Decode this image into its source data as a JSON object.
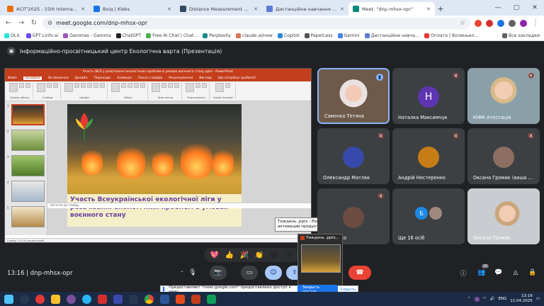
{
  "browser": {
    "tabs": [
      {
        "title": "ACIT'2025 - 15th International",
        "color": "#e8710a",
        "active": false
      },
      {
        "title": "Вхід | Kleks",
        "color": "#1a73e8",
        "active": false
      },
      {
        "title": "Distance Measurement using A",
        "color": "#34495e",
        "active": false
      },
      {
        "title": "Дистанційне навчання в ВСП",
        "color": "#5b7bd5",
        "active": false
      },
      {
        "title": "Meet: \"dnp-mhsx-opr\"",
        "color": "#00897b",
        "active": true
      }
    ],
    "url": "meet.google.com/dnp-mhsx-opr",
    "bookmarks": [
      {
        "label": "OLX.",
        "color": "#23e5db"
      },
      {
        "label": "GPT Linfo.ai",
        "color": "#6c4cf2"
      },
      {
        "label": "Gammas - Gamma",
        "color": "#9b59b6"
      },
      {
        "label": "ChatGPT",
        "color": "#202124"
      },
      {
        "label": "Free AI Chat | Chat...",
        "color": "#4caf50"
      },
      {
        "label": "Perplexity",
        "color": "#1f8a8a"
      },
      {
        "label": "claude.ai/new",
        "color": "#d97757"
      },
      {
        "label": "Copilot",
        "color": "#2b88d8"
      },
      {
        "label": "PaperLess",
        "color": "#555"
      },
      {
        "label": "Gemini",
        "color": "#4285f4"
      },
      {
        "label": "Дистанційне навча...",
        "color": "#5b7bd5"
      },
      {
        "label": "Оплата | Волиньел...",
        "color": "#e53935"
      }
    ],
    "all_bookmarks": "Все закладки"
  },
  "meet": {
    "presenter_title": "Інформаційно-просвітницький центр Екологічна варта (Презентація)",
    "time": "13:16",
    "meeting_code": "dnp-mhsx-opr",
    "participants_count": "28",
    "participants": [
      {
        "name": "Самочко Тетяна",
        "type": "video",
        "muted": false,
        "speaking": true
      },
      {
        "name": "Наталка Максимчук",
        "type": "avatar",
        "initial": "Н",
        "color": "#5e35b1",
        "muted": true
      },
      {
        "name": "КІФК Атестація",
        "type": "video",
        "muted": true
      },
      {
        "name": "Олександр Матлак",
        "type": "avatar-img",
        "color": "#3949ab",
        "muted": true
      },
      {
        "name": "Андрій Нестеренко",
        "type": "avatar-img",
        "color": "#c77d15",
        "muted": true
      },
      {
        "name": "Оксана Громик (ваша ...",
        "type": "avatar-img",
        "color": "#8d6e63",
        "muted": true
      },
      {
        "name": "Шепітько",
        "type": "avatar-img",
        "color": "#6d4c41",
        "muted": true
      },
      {
        "name": "Ще 16 осіб",
        "type": "more",
        "initial": "Б",
        "color": "#1e88e5",
        "muted": false
      },
      {
        "name": "Оксана Громик",
        "type": "video",
        "muted": false
      }
    ],
    "reactions": [
      "💖",
      "👍",
      "🎉",
      "👏",
      "😂",
      "😮"
    ]
  },
  "powerpoint": {
    "window_title": "Участь ВЕЛ у розв'язанні екологічних проблем в умовах воєнного стану.pptx - PowerPoint",
    "menu": [
      "Файл",
      "Основне",
      "Вставлення",
      "Дизайн",
      "Переходи",
      "Анімація",
      "Показ слайдів",
      "Рецензування",
      "Вигляд",
      "Що потрібно зробити?"
    ],
    "ribbon_groups": [
      "Буфер обміну",
      "Слайди",
      "Шрифт",
      "Абзац",
      "Креслення",
      "Редагування",
      "Adobe Acrobat"
    ],
    "slide_text": "Участь Всеукраїнської екологічної ліги у розв'язанні екологічних проблем в умовах воєнного стану",
    "notes": "Нотатки до слайду",
    "status": "Слайд 1 із 16   український",
    "thumb_numbers": [
      "1",
      "2",
      "3",
      "4",
      "5"
    ]
  },
  "tooltip": "Тиждень .pptx - PowerPoint (Сбой активации продукта)",
  "preview_title": "Тиждень .pptx...",
  "sharebar": {
    "text": "Предоставляет \"meet.google.com\" предоставлено доступ к окну",
    "stop": "Закрыть доступ",
    "hide": "Скрыть"
  },
  "taskbar": {
    "lang": "ENG",
    "time": "13:16",
    "date": "11.04.2025"
  }
}
